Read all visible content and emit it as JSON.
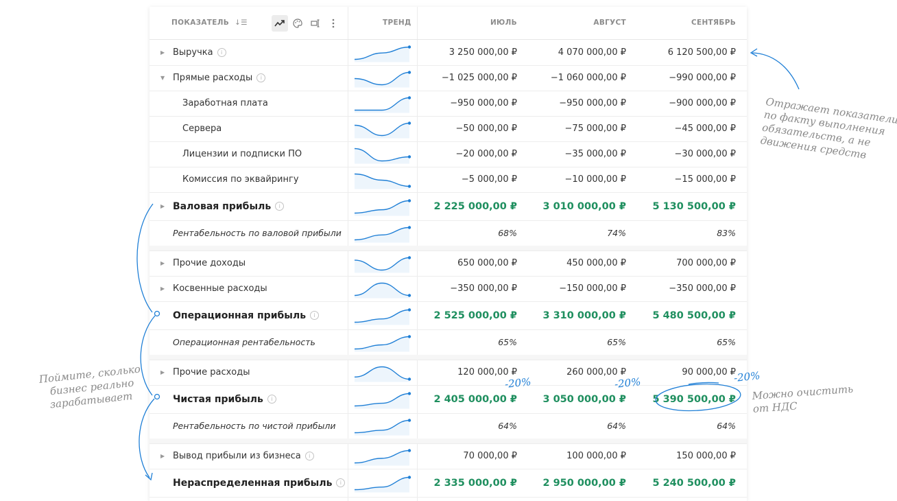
{
  "header": {
    "indicator_label": "ПОКАЗАТЕЛЬ",
    "trend_label": "ТРЕНД",
    "months": [
      "ИЮЛЬ",
      "АВГУСТ",
      "СЕНТЯБРЬ"
    ]
  },
  "rows": [
    {
      "name": "Выручка",
      "values": [
        "3 250 000,00 ₽",
        "4 070 000,00 ₽",
        "6 120 500,00 ₽"
      ],
      "trend": [
        0.0,
        0.52,
        1.0
      ]
    },
    {
      "name": "Прямые расходы",
      "values": [
        "−1 025 000,00 ₽",
        "−1 060 000,00 ₽",
        "−990 000,00 ₽"
      ],
      "trend": [
        -1025,
        -1060,
        -990
      ]
    },
    {
      "name": "Заработная плата",
      "values": [
        "−950 000,00 ₽",
        "−950 000,00 ₽",
        "−900 000,00 ₽"
      ],
      "trend": [
        -950,
        -950,
        -900
      ]
    },
    {
      "name": "Сервера",
      "values": [
        "−50 000,00 ₽",
        "−75 000,00 ₽",
        "−45 000,00 ₽"
      ],
      "trend": [
        -50,
        -75,
        -45
      ]
    },
    {
      "name": "Лицензии и подписки ПО",
      "values": [
        "−20 000,00 ₽",
        "−35 000,00 ₽",
        "−30 000,00 ₽"
      ],
      "trend": [
        -20,
        -35,
        -30
      ]
    },
    {
      "name": "Комиссия по эквайрингу",
      "values": [
        "−5 000,00 ₽",
        "−10 000,00 ₽",
        "−15 000,00 ₽"
      ],
      "trend": [
        -5,
        -10,
        -15
      ]
    },
    {
      "name": "Валовая прибыль",
      "values": [
        "2 225 000,00 ₽",
        "3 010 000,00 ₽",
        "5 130 500,00 ₽"
      ],
      "trend": [
        2225,
        3010,
        5130
      ]
    },
    {
      "name": "Рентабельность по валовой прибыли",
      "values": [
        "68%",
        "74%",
        "83%"
      ],
      "trend": [
        68,
        74,
        83
      ]
    },
    {
      "name": "Прочие доходы",
      "values": [
        "650 000,00 ₽",
        "450 000,00 ₽",
        "700 000,00 ₽"
      ],
      "trend": [
        650,
        450,
        700
      ]
    },
    {
      "name": "Косвенные расходы",
      "values": [
        "−350 000,00 ₽",
        "−150 000,00 ₽",
        "−350 000,00 ₽"
      ],
      "trend": [
        -350,
        -150,
        -350
      ]
    },
    {
      "name": "Операционная прибыль",
      "values": [
        "2 525 000,00 ₽",
        "3 310 000,00 ₽",
        "5 480 500,00 ₽"
      ],
      "trend": [
        2525,
        3310,
        5480
      ]
    },
    {
      "name": "Операционная рентабельность",
      "values": [
        "65%",
        "65%",
        "65%"
      ],
      "trend": [
        60,
        65,
        75
      ]
    },
    {
      "name": "Прочие расходы",
      "values": [
        "120 000,00 ₽",
        "260 000,00 ₽",
        "90 000,00 ₽"
      ],
      "trend": [
        120,
        260,
        90
      ]
    },
    {
      "name": "Чистая прибыль",
      "values": [
        "2 405 000,00 ₽",
        "3 050 000,00 ₽",
        "5 390 500,00 ₽"
      ],
      "trend": [
        2405,
        3050,
        5390
      ]
    },
    {
      "name": "Рентабельность по чистой прибыли",
      "values": [
        "64%",
        "64%",
        "64%"
      ],
      "trend": [
        60,
        62,
        70
      ]
    },
    {
      "name": "Вывод прибыли из бизнеса",
      "values": [
        "70 000,00 ₽",
        "100 000,00 ₽",
        "150 000,00 ₽"
      ],
      "trend": [
        70,
        100,
        150
      ]
    },
    {
      "name": "Нераспределенная прибыль",
      "values": [
        "2 335 000,00 ₽",
        "2 950 000,00 ₽",
        "5 240 500,00 ₽"
      ],
      "trend": [
        2335,
        2950,
        5240
      ]
    }
  ],
  "annotations": {
    "note_accrual": [
      "Отражает показатели",
      "по факту выполнения",
      "обязательств, а не",
      "движения средств"
    ],
    "note_profit": [
      "Поймите, сколько",
      "бизнес реально",
      "зарабатывает"
    ],
    "note_vat": [
      "Можно очистить",
      "от НДС"
    ],
    "discount": "-20%"
  },
  "colors": {
    "accent": "#1f7fd6",
    "profit": "#1f8f5f"
  }
}
